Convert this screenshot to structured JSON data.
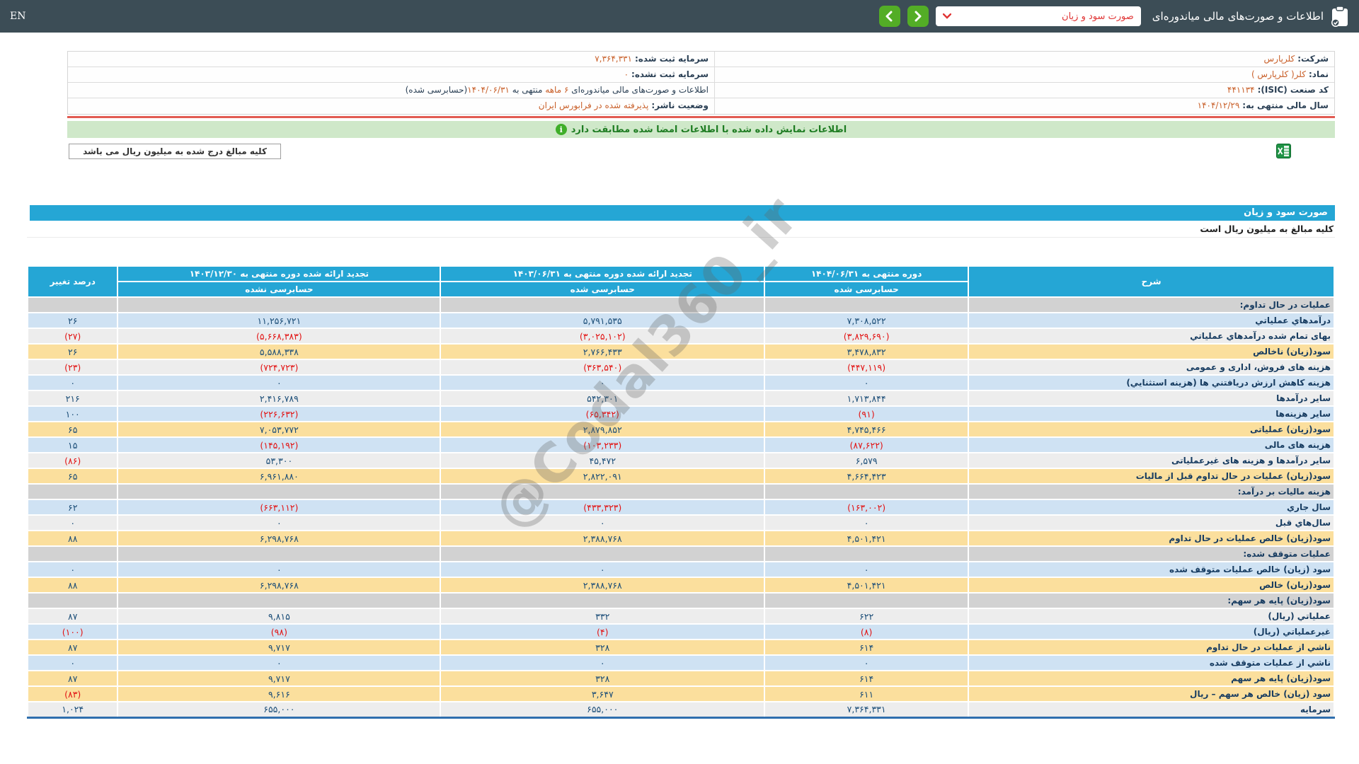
{
  "colors": {
    "topbar_bg": "#3c4d56",
    "button_green": "#53ad26",
    "dropdown_text_red": "#e03535",
    "header_cyan": "#25a6d5",
    "row_blue": "#cfe2f3",
    "row_gray": "#ededed",
    "row_yellow": "#fbdf9d",
    "row_section": "#d2d2d2",
    "value_navy": "#1c4e78",
    "negative_red": "#e21414",
    "accent_orange": "#c9602a",
    "banner_green_bg": "#cfe8c9",
    "banner_green_text": "#1e7c22",
    "red_separator": "#e25b52"
  },
  "top_bar": {
    "en_label": "EN",
    "title": "اطلاعات و صورت‌های مالی میاندوره‌ای",
    "statement_dropdown": {
      "value": "صورت سود و زیان"
    }
  },
  "company_info": {
    "rows_right": [
      {
        "label": "شرکت:",
        "value": "کلرپارس",
        "link": true
      },
      {
        "label": "نماد:",
        "value": "کلر( کلرپارس )",
        "link": true
      },
      {
        "label": "کد صنعت (ISIC):",
        "value": "۴۴۱۱۳۴",
        "link": false
      },
      {
        "label": "سال مالی منتهی به:",
        "value": "۱۴۰۴/۱۲/۲۹",
        "link": false
      }
    ],
    "rows_left": [
      {
        "label": "سرمایه ثبت شده:",
        "value": "۷,۳۶۴,۳۳۱",
        "link": false
      },
      {
        "label": "سرمایه ثبت نشده:",
        "value": "۰",
        "link": false
      },
      {
        "parts": [
          {
            "text": "اطلاعات و صورت‌های مالی میاندوره‌ای ",
            "accent": false
          },
          {
            "text": "۶ ماهه",
            "accent": true
          },
          {
            "text": " منتهی به ",
            "accent": false
          },
          {
            "text": "۱۴۰۴/۰۶/۳۱",
            "accent": true
          },
          {
            "text": "(حسابرسی شده)",
            "accent": false
          }
        ]
      },
      {
        "label": "وضعیت ناشر:",
        "value": "پذیرفته شده در فرابورس ایران",
        "link": false
      }
    ]
  },
  "signature_banner": "اطلاعات نمایش داده شده با اطلاعات امضا شده مطابقت دارد",
  "amount_note": "کلیه مبالغ درج شده به میلیون ریال می باشد",
  "statement_section": {
    "title": "صورت سود و زیان",
    "unit_note": "کلیه مبالغ به میلیون ریال است"
  },
  "table": {
    "headers": {
      "desc": "شرح",
      "period_current": {
        "title": "دوره منتهی به ۱۴۰۴/۰۶/۳۱",
        "sub": "حسابرسی شده"
      },
      "period_restated_mid": {
        "title": "تجدید ارائه شده دوره منتهی به ۱۴۰۳/۰۶/۳۱",
        "sub": "حسابرسی شده"
      },
      "period_restated_year": {
        "title": "تجدید ارائه شده دوره منتهی به ۱۴۰۳/۱۲/۳۰",
        "sub": "حسابرسی نشده"
      },
      "pct_change": "درصد تغییر"
    },
    "rows": [
      {
        "type": "section",
        "label": "عملیات در حال تداوم:",
        "values": [
          "",
          "",
          ""
        ],
        "pct": ""
      },
      {
        "type": "blue",
        "label": "درآمدهاي عملياتي",
        "values": [
          "۷,۳۰۸,۵۲۲",
          "۵,۷۹۱,۵۳۵",
          "۱۱,۲۵۶,۷۲۱"
        ],
        "pct": "۲۶"
      },
      {
        "type": "plain",
        "label": "بهای تمام شده درآمدهاي عملياتي",
        "values": [
          "(۳,۸۲۹,۶۹۰)",
          "(۳,۰۲۵,۱۰۲)",
          "(۵,۶۶۸,۳۸۳)"
        ],
        "pct": "(۲۷)"
      },
      {
        "type": "yellow",
        "label": "سود(زیان) ناخالص",
        "values": [
          "۳,۴۷۸,۸۳۲",
          "۲,۷۶۶,۴۳۳",
          "۵,۵۸۸,۳۳۸"
        ],
        "pct": "۲۶"
      },
      {
        "type": "plain",
        "label": "هزینه های فروش، اداری و عمومی",
        "values": [
          "(۴۴۷,۱۱۹)",
          "(۳۶۳,۵۴۰)",
          "(۷۲۴,۷۲۳)"
        ],
        "pct": "(۲۳)"
      },
      {
        "type": "blue",
        "label": "هزینه کاهش ارزش دریافتني ها (هزینه استثنایي)",
        "values": [
          "۰",
          "۰",
          "۰"
        ],
        "pct": "۰"
      },
      {
        "type": "plain",
        "label": "سایر درآمدها",
        "values": [
          "۱,۷۱۳,۸۴۴",
          "۵۴۲,۳۰۱",
          "۲,۴۱۶,۷۸۹"
        ],
        "pct": "۲۱۶"
      },
      {
        "type": "blue",
        "label": "سایر هزینه‌ها",
        "values": [
          "(۹۱)",
          "(۶۵,۳۴۲)",
          "(۲۲۶,۶۳۲)"
        ],
        "pct": "۱۰۰"
      },
      {
        "type": "yellow",
        "label": "سود(زیان) عملیاتی",
        "values": [
          "۴,۷۴۵,۴۶۶",
          "۲,۸۷۹,۸۵۲",
          "۷,۰۵۳,۷۷۲"
        ],
        "pct": "۶۵"
      },
      {
        "type": "blue",
        "label": "هزینه های مالی",
        "values": [
          "(۸۷,۶۲۲)",
          "(۱۰۳,۲۳۳)",
          "(۱۴۵,۱۹۲)"
        ],
        "pct": "۱۵"
      },
      {
        "type": "plain",
        "label": "سایر درآمدها و هزینه های غیرعملیاتی",
        "values": [
          "۶,۵۷۹",
          "۴۵,۴۷۲",
          "۵۳,۳۰۰"
        ],
        "pct": "(۸۶)"
      },
      {
        "type": "yellow",
        "label": "سود(زیان) عملیات در حال تداوم قبل از مالیات",
        "values": [
          "۴,۶۶۴,۴۲۳",
          "۲,۸۲۲,۰۹۱",
          "۶,۹۶۱,۸۸۰"
        ],
        "pct": "۶۵"
      },
      {
        "type": "section",
        "label": "هزینه مالیات بر درآمد:",
        "values": [
          "",
          "",
          ""
        ],
        "pct": ""
      },
      {
        "type": "blue",
        "label": "سال جاري",
        "values": [
          "(۱۶۳,۰۰۲)",
          "(۴۳۳,۳۲۳)",
          "(۶۶۳,۱۱۲)"
        ],
        "pct": "۶۲"
      },
      {
        "type": "plain",
        "label": "سال‌هاي قبل",
        "values": [
          "۰",
          "۰",
          "۰"
        ],
        "pct": "۰"
      },
      {
        "type": "yellow",
        "label": "سود(زیان) خالص عملیات در حال تداوم",
        "values": [
          "۴,۵۰۱,۴۲۱",
          "۲,۳۸۸,۷۶۸",
          "۶,۲۹۸,۷۶۸"
        ],
        "pct": "۸۸"
      },
      {
        "type": "section",
        "label": "عملیات متوقف شده:",
        "values": [
          "",
          "",
          ""
        ],
        "pct": ""
      },
      {
        "type": "blue",
        "label": "سود (زیان) خالص عملیات متوقف شده",
        "values": [
          "۰",
          "۰",
          "۰"
        ],
        "pct": "۰"
      },
      {
        "type": "yellow",
        "label": "سود(زیان) خالص",
        "values": [
          "۴,۵۰۱,۴۲۱",
          "۲,۳۸۸,۷۶۸",
          "۶,۲۹۸,۷۶۸"
        ],
        "pct": "۸۸"
      },
      {
        "type": "section",
        "label": "سود(زیان) پایه هر سهم:",
        "values": [
          "",
          "",
          ""
        ],
        "pct": ""
      },
      {
        "type": "plain",
        "label": "عملیاتي (ریال)",
        "values": [
          "۶۲۲",
          "۳۳۲",
          "۹,۸۱۵"
        ],
        "pct": "۸۷"
      },
      {
        "type": "blue",
        "label": "غیرعملیاتي (ریال)",
        "values": [
          "(۸)",
          "(۴)",
          "(۹۸)"
        ],
        "pct": "(۱۰۰)"
      },
      {
        "type": "yellow",
        "label": "ناشي از عملیات در حال تداوم",
        "values": [
          "۶۱۴",
          "۳۲۸",
          "۹,۷۱۷"
        ],
        "pct": "۸۷"
      },
      {
        "type": "blue",
        "label": "ناشي از عملیات متوقف شده",
        "values": [
          "۰",
          "۰",
          "۰"
        ],
        "pct": "۰"
      },
      {
        "type": "yellow",
        "label": "سود(زیان) پایه هر سهم",
        "values": [
          "۶۱۴",
          "۳۲۸",
          "۹,۷۱۷"
        ],
        "pct": "۸۷"
      },
      {
        "type": "yellow",
        "label": "سود (زیان) خالص هر سهم – ریال",
        "values": [
          "۶۱۱",
          "۳,۶۴۷",
          "۹,۶۱۶"
        ],
        "pct": "(۸۳)"
      },
      {
        "type": "plain",
        "label": "سرمایه",
        "values": [
          "۷,۳۶۴,۳۳۱",
          "۶۵۵,۰۰۰",
          "۶۵۵,۰۰۰"
        ],
        "pct": "۱,۰۲۴"
      }
    ]
  },
  "watermark": "@Codal360_ir"
}
